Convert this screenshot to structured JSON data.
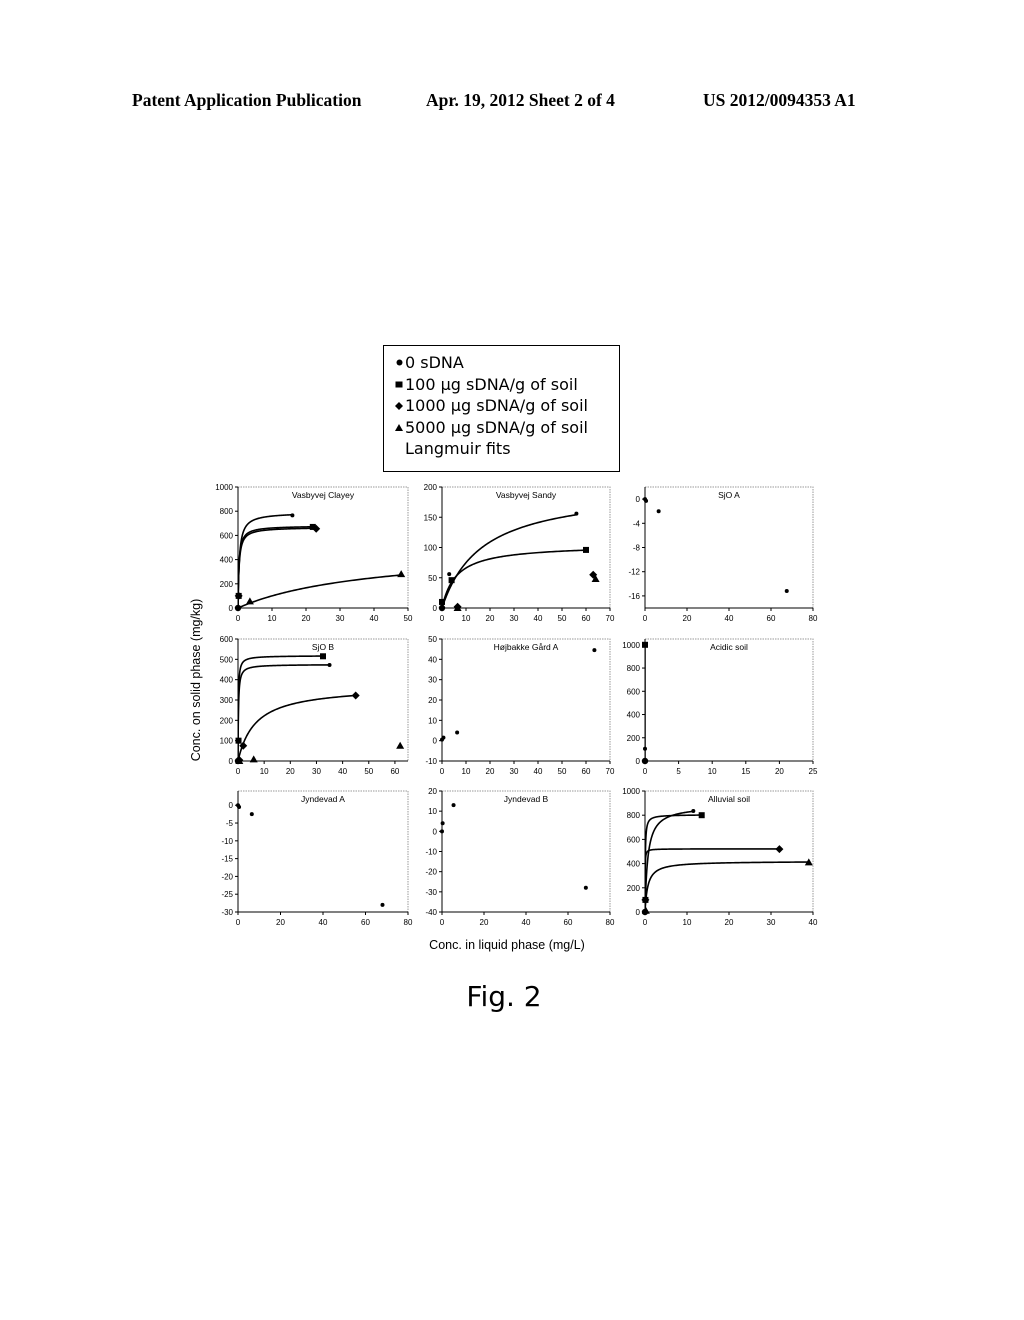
{
  "header": {
    "left": "Patent Application Publication",
    "middle": "Apr. 19, 2012  Sheet 2 of 4",
    "right": "US 2012/0094353 A1"
  },
  "figure_label": "Fig. 2",
  "legend": [
    {
      "marker": "circle",
      "label": "0 sDNA"
    },
    {
      "marker": "square",
      "label": "100 µg sDNA/g of soil"
    },
    {
      "marker": "diamond",
      "label": "1000 µg sDNA/g of soil"
    },
    {
      "marker": "triangle",
      "label": "5000 µg sDNA/g of soil"
    },
    {
      "marker": "none",
      "label": "Langmuir fits"
    }
  ],
  "axes": {
    "ylabel": "Conc. on solid phase (mg/kg)",
    "xlabel": "Conc. in liquid phase (mg/L)"
  },
  "chart_data": [
    {
      "type": "scatter",
      "title": "Vasbyvej Clayey",
      "xlim": [
        0,
        50
      ],
      "xticks": [
        0,
        10,
        20,
        30,
        40,
        50
      ],
      "ylim": [
        0,
        1000
      ],
      "yticks": [
        0,
        200,
        400,
        600,
        800,
        1000
      ],
      "series": [
        {
          "name": "0 sDNA",
          "marker": "circle",
          "points": [
            [
              0,
              0
            ],
            [
              0.3,
              5
            ],
            [
              16,
              765
            ]
          ],
          "fit": {
            "qmax": 790,
            "k": 2.5
          }
        },
        {
          "name": "100 µg sDNA/g of soil",
          "marker": "square",
          "points": [
            [
              0.2,
              100
            ],
            [
              22,
              670
            ]
          ],
          "fit": {
            "qmax": 680,
            "k": 3.5
          }
        },
        {
          "name": "1000 µg sDNA/g of soil",
          "marker": "diamond",
          "points": [
            [
              0.2,
              100
            ],
            [
              23,
              655
            ]
          ],
          "fit": {
            "qmax": 668,
            "k": 3.2
          }
        },
        {
          "name": "5000 µg sDNA/g of soil",
          "marker": "triangle",
          "points": [
            [
              3.5,
              55
            ],
            [
              48,
              280
            ]
          ],
          "fit": {
            "qmax": 500,
            "k": 0.025
          }
        }
      ]
    },
    {
      "type": "scatter",
      "title": "Vasbyvej Sandy",
      "xlim": [
        0,
        70
      ],
      "xticks": [
        0,
        10,
        20,
        30,
        40,
        50,
        60,
        70
      ],
      "ylim": [
        0,
        200
      ],
      "yticks": [
        0,
        50,
        100,
        150,
        200
      ],
      "series": [
        {
          "name": "0 sDNA",
          "marker": "circle",
          "points": [
            [
              0,
              0
            ],
            [
              3,
              56
            ],
            [
              56,
              156
            ]
          ],
          "fit": {
            "qmax": 200,
            "k": 0.06
          }
        },
        {
          "name": "100 µg sDNA/g of soil",
          "marker": "square",
          "points": [
            [
              0,
              10
            ],
            [
              4,
              46
            ],
            [
              60,
              96
            ]
          ],
          "fit": {
            "qmax": 105,
            "k": 0.17
          }
        },
        {
          "name": "1000 µg sDNA/g of soil",
          "marker": "diamond",
          "points": [
            [
              6.5,
              2
            ],
            [
              63,
              55
            ]
          ]
        },
        {
          "name": "5000 µg sDNA/g of soil",
          "marker": "triangle",
          "points": [
            [
              6.5,
              0
            ],
            [
              64,
              48
            ]
          ]
        }
      ]
    },
    {
      "type": "scatter",
      "title": "SjO A",
      "xlim": [
        0,
        80
      ],
      "xticks": [
        0,
        20,
        40,
        60,
        80
      ],
      "ylim": [
        -18,
        2
      ],
      "yticks": [
        -16,
        -12,
        -8,
        -4,
        0
      ],
      "series": [
        {
          "name": "0 sDNA",
          "marker": "circle",
          "points": [
            [
              0,
              0
            ],
            [
              0.5,
              -0.3
            ],
            [
              6.5,
              -2
            ],
            [
              67.5,
              -15.2
            ]
          ]
        }
      ]
    },
    {
      "type": "scatter",
      "title": "SjO B",
      "xlim": [
        0,
        65
      ],
      "xticks": [
        0,
        10,
        20,
        30,
        40,
        50,
        60
      ],
      "ylim": [
        0,
        600
      ],
      "yticks": [
        0,
        100,
        200,
        300,
        400,
        500,
        600
      ],
      "series": [
        {
          "name": "0 sDNA",
          "marker": "circle",
          "points": [
            [
              0,
              0
            ],
            [
              0.2,
              10
            ],
            [
              35,
              472
            ]
          ],
          "fit": {
            "qmax": 475,
            "k": 6
          }
        },
        {
          "name": "100 µg sDNA/g of soil",
          "marker": "square",
          "points": [
            [
              0.2,
              100
            ],
            [
              32.5,
              515
            ]
          ],
          "fit": {
            "qmax": 518,
            "k": 8
          }
        },
        {
          "name": "1000 µg sDNA/g of soil",
          "marker": "diamond",
          "points": [
            [
              0.5,
              5
            ],
            [
              2,
              75
            ],
            [
              45,
              322
            ]
          ],
          "fit": {
            "qmax": 370,
            "k": 0.15
          }
        },
        {
          "name": "5000 µg sDNA/g of soil",
          "marker": "triangle",
          "points": [
            [
              0.5,
              0
            ],
            [
              6,
              8
            ],
            [
              62,
              75
            ]
          ]
        }
      ]
    },
    {
      "type": "scatter",
      "title": "Højbakke Gård A",
      "xlim": [
        0,
        70
      ],
      "xticks": [
        0,
        10,
        20,
        30,
        40,
        50,
        60,
        70
      ],
      "ylim": [
        -10,
        50
      ],
      "yticks": [
        -10,
        0,
        10,
        20,
        30,
        40,
        50
      ],
      "series": [
        {
          "name": "0 sDNA",
          "marker": "circle",
          "points": [
            [
              0,
              0.5
            ],
            [
              0.6,
              1.5
            ],
            [
              6.3,
              4
            ],
            [
              63.5,
              44.5
            ]
          ]
        }
      ]
    },
    {
      "type": "scatter",
      "title": "Acidic soil",
      "xlim": [
        0,
        25
      ],
      "xticks": [
        0,
        5,
        10,
        15,
        20,
        25
      ],
      "ylim": [
        0,
        1050
      ],
      "yticks": [
        0,
        200,
        400,
        600,
        800,
        1000
      ],
      "series": [
        {
          "name": "0 sDNA",
          "marker": "circle",
          "points": [
            [
              0,
              0
            ],
            [
              0,
              10
            ],
            [
              0,
              105
            ]
          ]
        },
        {
          "name": "100 µg sDNA/g of soil",
          "marker": "square",
          "points": [
            [
              0,
              1000
            ]
          ],
          "fit": {
            "vertical_x": 0
          }
        }
      ]
    },
    {
      "type": "scatter",
      "title": "Jyndevad A",
      "xlim": [
        0,
        80
      ],
      "xticks": [
        0,
        20,
        40,
        60,
        80
      ],
      "ylim": [
        -30,
        4
      ],
      "yticks": [
        -30,
        -25,
        -20,
        -15,
        -10,
        -5,
        0
      ],
      "series": [
        {
          "name": "0 sDNA",
          "marker": "circle",
          "points": [
            [
              0,
              0
            ],
            [
              0.5,
              -0.5
            ],
            [
              6.5,
              -2.5
            ],
            [
              68,
              -28
            ]
          ]
        }
      ]
    },
    {
      "type": "scatter",
      "title": "Jyndevad B",
      "xlim": [
        0,
        80
      ],
      "xticks": [
        0,
        20,
        40,
        60,
        80
      ],
      "ylim": [
        -40,
        20
      ],
      "yticks": [
        -40,
        -30,
        -20,
        -10,
        0,
        10,
        20
      ],
      "series": [
        {
          "name": "0 sDNA",
          "marker": "circle",
          "points": [
            [
              0,
              0
            ],
            [
              0.3,
              4
            ],
            [
              5.5,
              13
            ],
            [
              68.5,
              -28
            ]
          ]
        }
      ]
    },
    {
      "type": "scatter",
      "title": "Alluvial soil",
      "xlim": [
        0,
        40
      ],
      "xticks": [
        0,
        10,
        20,
        30,
        40
      ],
      "ylim": [
        0,
        1000
      ],
      "yticks": [
        0,
        200,
        400,
        600,
        800,
        1000
      ],
      "series": [
        {
          "name": "0 sDNA",
          "marker": "circle",
          "points": [
            [
              0,
              0
            ],
            [
              0.2,
              5
            ],
            [
              11.5,
              835
            ]
          ],
          "fit": {
            "qmax": 880,
            "k": 1.5
          }
        },
        {
          "name": "100 µg sDNA/g of soil",
          "marker": "square",
          "points": [
            [
              0.1,
              100
            ],
            [
              13.5,
              800
            ]
          ],
          "fit": {
            "qmax": 805,
            "k": 15
          }
        },
        {
          "name": "1000 µg sDNA/g of soil",
          "marker": "diamond",
          "points": [
            [
              0.1,
              100
            ],
            [
              32,
              520
            ]
          ],
          "fit": {
            "qmax": 522,
            "k": 40
          }
        },
        {
          "name": "5000 µg sDNA/g of soil",
          "marker": "triangle",
          "points": [
            [
              0.2,
              10
            ],
            [
              39,
              410
            ]
          ],
          "fit": {
            "qmax": 420,
            "k": 1.5
          }
        }
      ]
    }
  ]
}
